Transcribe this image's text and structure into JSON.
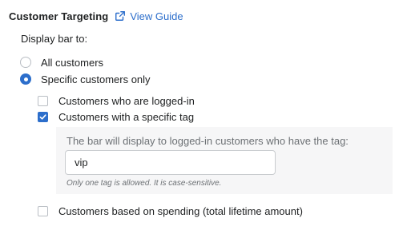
{
  "section": {
    "title": "Customer Targeting",
    "guide_link": "View Guide"
  },
  "display_bar": {
    "label": "Display bar to:",
    "options": [
      {
        "label": "All customers",
        "selected": false
      },
      {
        "label": "Specific customers only",
        "selected": true
      }
    ]
  },
  "specific": {
    "logged_in": {
      "label": "Customers who are logged-in",
      "checked": false
    },
    "specific_tag": {
      "label": "Customers with a specific tag",
      "checked": true
    },
    "spending": {
      "label": "Customers based on spending (total lifetime amount)",
      "checked": false
    }
  },
  "tag": {
    "label": "The bar will display to logged-in customers who have the tag:",
    "value": "vip",
    "help": "Only one tag is allowed. It is case-sensitive."
  },
  "colors": {
    "accent": "#2c6ecb",
    "panel": "#f6f6f7"
  }
}
